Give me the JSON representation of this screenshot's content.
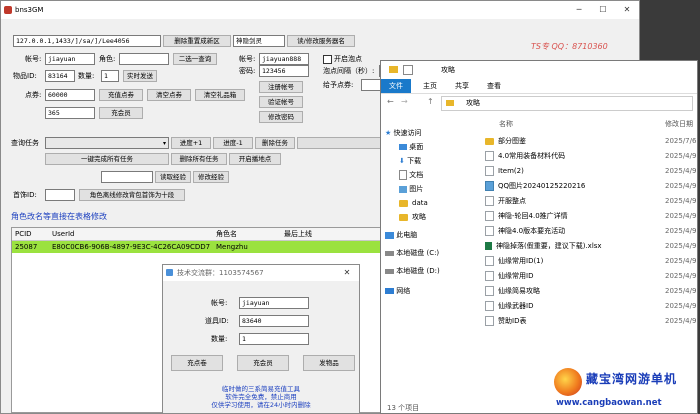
{
  "main": {
    "title": "bns3GM",
    "server_address": "127.0.0.1,1433/]/sa/]/Lee4056",
    "btn_refresh_new_server": "删除重置成新区",
    "server_name": "神隐剑灵",
    "btn_modify_server": "读/修改服务器名",
    "account_label": "帐号:",
    "account_value": "jiayuan",
    "role_label": "角色:",
    "role_value": "",
    "btn_choose_one": "二选一查询",
    "account2_label": "帐号:",
    "account2_value": "jiayuan888",
    "password_label": "密码:",
    "password_value": "123456",
    "chk_open_point": "开启泡点",
    "point_interval_label": "泡点间隔（秒）:",
    "point_interval_value": "",
    "give_point_label": "给予点券:",
    "give_point_value": "",
    "item_id_label": "物品ID:",
    "item_id_value": "83164",
    "qty_label": "数量:",
    "qty_value": "1",
    "btn_realtime_send": "实时发送",
    "points_label": "点券:",
    "points_value": "60000",
    "btn_recharge_points": "充值点券",
    "btn_clear_points": "清空点券",
    "btn_clear_gifts": "清空礼品箱",
    "vip_value": "365",
    "btn_recharge_vip": "充会员",
    "btn_register": "注册帐号",
    "btn_verify": "验证帐号",
    "btn_change_pwd": "修改密码",
    "query_task_label": "查询任务",
    "task_select_value": "",
    "btn_progress_plus": "进度+1",
    "btn_progress_minus": "进度-1",
    "btn_delete_task": "删除任务",
    "btn_complete_all": "一键完成所有任务",
    "btn_delete_all": "删除所有任务",
    "btn_open_map": "开启播地点",
    "read_exp_value": "",
    "btn_read_exp": "读取经验",
    "btn_modify_exp": "修改经验",
    "first_id_label": "首饰ID:",
    "first_id_value": "",
    "btn_backpack": "角色离线修改背包首饰为十段",
    "table_caption": "角色改名等直接在表格修改",
    "table_columns": [
      "PCID",
      "UserId",
      "角色名",
      "最后上线"
    ],
    "table_rows": [
      {
        "pcid": "25087",
        "userid": "E80C0CB6-906B-4897-9E3C-4C26CA09CDD7",
        "name": "Mengzhu",
        "last": ""
      }
    ],
    "watermark_text": "TS专 QQ：8710360"
  },
  "dialog": {
    "title": "技术交流群：1103574567",
    "account_label": "帐号:",
    "account_value": "jiayuan",
    "item_id_label": "道具ID:",
    "item_id_value": "83640",
    "qty_label": "数量:",
    "qty_value": "1",
    "btn_points": "充点卷",
    "btn_vip": "充会员",
    "btn_item": "发物品",
    "notice_line1": "临时做的三系简易充值工具",
    "notice_line2": "软件完全免费，禁止商用",
    "notice_line3": "仅供学习使用，请在24小时内删除"
  },
  "explorer": {
    "title": "攻略",
    "tab_file": "文件",
    "tab_home": "主页",
    "tab_share": "共享",
    "tab_view": "查看",
    "breadcrumb": "攻略",
    "col_name": "名称",
    "col_date": "修改日期",
    "nav": [
      {
        "label": "快速访问",
        "icon": "star-icon"
      },
      {
        "label": "桌面",
        "icon": "desktop-icon"
      },
      {
        "label": "下载",
        "icon": "download-icon"
      },
      {
        "label": "文档",
        "icon": "document-icon"
      },
      {
        "label": "图片",
        "icon": "picture-icon"
      },
      {
        "label": "data",
        "icon": "folder-icon"
      },
      {
        "label": "攻略",
        "icon": "folder-icon"
      },
      {
        "label": "此电脑",
        "icon": "computer-icon"
      },
      {
        "label": "本地磁盘 (C:)",
        "icon": "disk-icon"
      },
      {
        "label": "本地磁盘 (D:)",
        "icon": "disk-icon"
      },
      {
        "label": "网络",
        "icon": "network-icon"
      }
    ],
    "files": [
      {
        "name": "部分图鉴",
        "date": "2025/7/6",
        "type": "folder"
      },
      {
        "name": "4.0常用装备材料代码",
        "date": "2025/4/9",
        "type": "doc"
      },
      {
        "name": "Item(2)",
        "date": "2025/4/9",
        "type": "doc"
      },
      {
        "name": "QQ图片20240125220216",
        "date": "2025/4/9",
        "type": "img"
      },
      {
        "name": "开服整点",
        "date": "2025/4/9",
        "type": "doc"
      },
      {
        "name": "神隐-轮回4.0推广详情",
        "date": "2025/4/9",
        "type": "doc"
      },
      {
        "name": "神隐4.0版本要充活动",
        "date": "2025/4/9",
        "type": "doc"
      },
      {
        "name": "神隐掉落(假重要，建议下载).xlsx",
        "date": "2025/4/9",
        "type": "xl"
      },
      {
        "name": "仙缘常用ID(1)",
        "date": "2025/4/9",
        "type": "doc"
      },
      {
        "name": "仙缘常用ID",
        "date": "2025/4/9",
        "type": "doc"
      },
      {
        "name": "仙缘简易攻略",
        "date": "2025/4/9",
        "type": "doc"
      },
      {
        "name": "仙缘武器ID",
        "date": "2025/4/9",
        "type": "doc"
      },
      {
        "name": "赞助ID表",
        "date": "2025/4/9",
        "type": "doc"
      }
    ],
    "status": "13 个项目"
  },
  "brand": {
    "name": "藏宝湾网游单机",
    "url": "www.cangbaowan.net"
  },
  "colors": {
    "selected_row": "#9be23f",
    "caption_blue": "#1b3fbf",
    "ribbon_file": "#1979ca",
    "brand_blue": "#1a3db8"
  }
}
